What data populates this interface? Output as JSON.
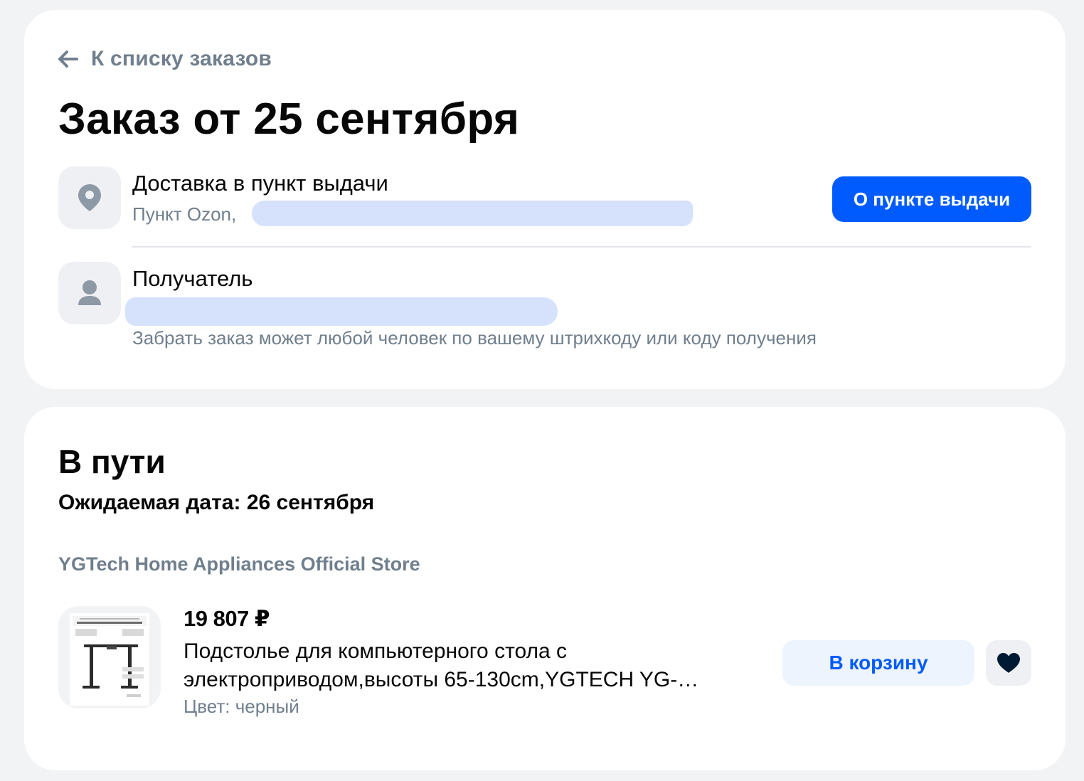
{
  "order": {
    "back_label": "К списку заказов",
    "title": "Заказ от 25 сентября",
    "delivery": {
      "title": "Доставка в пункт выдачи",
      "address_prefix": "Пункт Ozon,",
      "button_label": "О пункте выдачи"
    },
    "recipient": {
      "title": "Получатель",
      "note": "Забрать заказ может любой человек по вашему штрихкоду или коду получения"
    }
  },
  "shipment": {
    "status": "В пути",
    "expected_date": "Ожидаемая дата: 26 сентября",
    "seller": "YGTech Home Appliances Official Store",
    "product": {
      "price": "19 807 ₽",
      "name": "Подстолье для компьютерного стола с электроприводом,высоты 65-130cm,YGTECH YG-…",
      "color": "Цвет: черный",
      "cart_label": "В корзину"
    }
  },
  "colors": {
    "accent": "#005bff",
    "secondary_text": "#707f8d",
    "tile_bg": "#eef0f4",
    "redaction": "#d6e1fb",
    "favorite_heart": "#001a34"
  },
  "icons": {
    "back": "arrow-left-icon",
    "delivery": "location-pin-icon",
    "recipient": "person-icon",
    "favorite": "heart-icon"
  }
}
